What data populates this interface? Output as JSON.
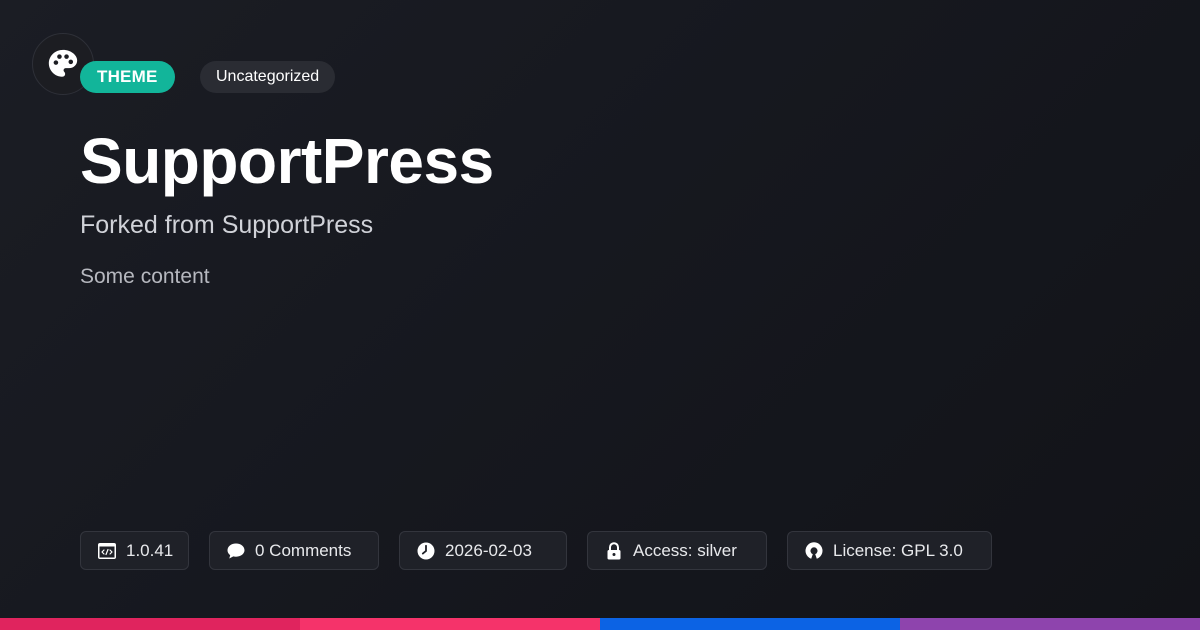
{
  "badge": {
    "type": "THEME",
    "category": "Uncategorized"
  },
  "title": "SupportPress",
  "subtitle": "Forked from SupportPress",
  "content": "Some content",
  "meta": {
    "version": "1.0.41",
    "comments": "0 Comments",
    "date": "2026-02-03",
    "access": "Access: silver",
    "license": "License: GPL 3.0"
  },
  "icons": {
    "logo": "palette-icon",
    "version": "code-window-icon",
    "comments": "speech-bubble-icon",
    "date": "clock-icon",
    "access": "lock-icon",
    "license": "open-source-icon"
  },
  "colors": {
    "background": "#16181f",
    "theme_badge": "#12b59a",
    "category_badge": "#2a2c33",
    "bar": [
      "#e0245e",
      "#f5336a",
      "#0c63e4",
      "#8e44ad"
    ]
  }
}
